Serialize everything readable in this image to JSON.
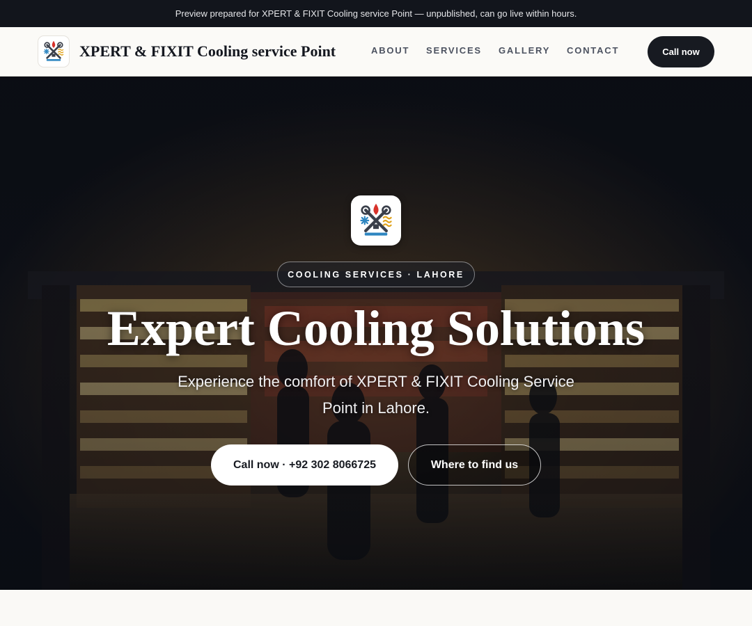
{
  "preview_bar": {
    "text": "Preview prepared for XPERT & FIXIT Cooling service Point — unpublished, can go live within hours."
  },
  "header": {
    "brand_name": "XPERT & FIXIT Cooling service Point",
    "logo_icon": "xpert-fixit-logo-icon",
    "nav": [
      {
        "label": "ABOUT"
      },
      {
        "label": "SERVICES"
      },
      {
        "label": "GALLERY"
      },
      {
        "label": "CONTACT"
      }
    ],
    "call_label": "Call now"
  },
  "hero": {
    "badge": "COOLING SERVICES · LAHORE",
    "title": "Expert Cooling Solutions",
    "subtitle": "Experience the comfort of XPERT & FIXIT Cooling Service Point in Lahore.",
    "primary_button": "Call now · +92 302 8066725",
    "secondary_button": "Where to find us",
    "background_image": "shop-interior-photo"
  },
  "colors": {
    "preview_bar_bg": "#12151c",
    "header_bg": "#fbfaf7",
    "dark_button": "#171a21",
    "nav_text": "#4c5260",
    "logo_flame": "#d8322a",
    "logo_snowflake": "#2e86c1",
    "logo_wave": "#e0a31c"
  }
}
